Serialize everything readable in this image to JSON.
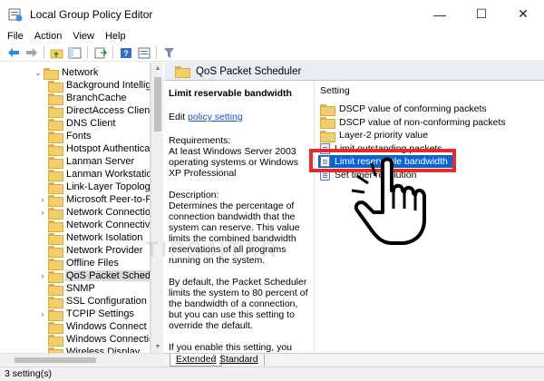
{
  "window": {
    "title": "Local Group Policy Editor",
    "controls": {
      "minimize": "—",
      "maximize": "☐",
      "close": "✕"
    }
  },
  "menu": [
    "File",
    "Action",
    "View",
    "Help"
  ],
  "toolbar": {
    "icons": [
      "back-arrow-icon",
      "forward-arrow-icon",
      "up-folder-icon",
      "show-hide-tree-icon",
      "export-list-icon",
      "help-icon",
      "properties-icon",
      "filter-icon"
    ]
  },
  "tree": {
    "items": [
      {
        "label": "Network",
        "arrow": "⌄",
        "indent": "l1"
      },
      {
        "label": "Background Intelligent Transfer Service",
        "indent": "l2"
      },
      {
        "label": "BranchCache",
        "indent": "l2"
      },
      {
        "label": "DirectAccess Client Experience Settings",
        "indent": "l2"
      },
      {
        "label": "DNS Client",
        "indent": "l2"
      },
      {
        "label": "Fonts",
        "indent": "l2"
      },
      {
        "label": "Hotspot Authentication",
        "indent": "l2"
      },
      {
        "label": "Lanman Server",
        "indent": "l2"
      },
      {
        "label": "Lanman Workstation",
        "indent": "l2"
      },
      {
        "label": "Link-Layer Topology Discovery",
        "indent": "l2"
      },
      {
        "label": "Microsoft Peer-to-Peer Networking Services",
        "arrow": "›",
        "indent": "l2"
      },
      {
        "label": "Network Connections",
        "arrow": "›",
        "indent": "l2"
      },
      {
        "label": "Network Connectivity Status Indicator",
        "indent": "l2"
      },
      {
        "label": "Network Isolation",
        "indent": "l2"
      },
      {
        "label": "Network Provider",
        "indent": "l2"
      },
      {
        "label": "Offline Files",
        "indent": "l2"
      },
      {
        "label": "QoS Packet Scheduler",
        "arrow": "›",
        "indent": "l2",
        "selected": true
      },
      {
        "label": "SNMP",
        "indent": "l2"
      },
      {
        "label": "SSL Configuration Settings",
        "indent": "l2"
      },
      {
        "label": "TCPIP Settings",
        "arrow": "›",
        "indent": "l2"
      },
      {
        "label": "Windows Connect Now",
        "indent": "l2"
      },
      {
        "label": "Windows Connection Manager",
        "indent": "l2"
      },
      {
        "label": "Wireless Display",
        "indent": "l2"
      }
    ]
  },
  "header": {
    "title": "QoS Packet Scheduler"
  },
  "description": {
    "title": "Limit reservable bandwidth",
    "edit_prefix": "Edit",
    "edit_link": "policy setting",
    "requirements": "Requirements:\nAt least Windows Server 2003 operating systems or Windows XP Professional",
    "description": "Description:\nDetermines the percentage of connection bandwidth that the system can reserve. This value limits the combined bandwidth reservations of all programs running on the system.",
    "default": "By default, the Packet Scheduler limits the system to 80 percent of the bandwidth of a connection, but you can use this setting to override the default.",
    "enable": "If you enable this setting, you can use the \"Bandwidth limit\" box to"
  },
  "list": {
    "column": "Setting",
    "items": [
      {
        "label": "DSCP value of conforming packets",
        "type": "folder"
      },
      {
        "label": "DSCP value of non-conforming packets",
        "type": "folder"
      },
      {
        "label": "Layer-2 priority value",
        "type": "folder"
      },
      {
        "label": "Limit outstanding packets",
        "type": "setting"
      },
      {
        "label": "Limit reservable bandwidth",
        "type": "setting",
        "selected": true
      },
      {
        "label": "Set timer resolution",
        "type": "setting"
      }
    ]
  },
  "tabs": {
    "extended": "Extended",
    "standard": "Standard"
  },
  "status": {
    "text": "3 setting(s)"
  },
  "watermark": "TIPS4ITAR",
  "colors": {
    "selection": "#0a64d1",
    "highlight_box": "#e52a2a",
    "header_bg": "#e9eef6"
  }
}
